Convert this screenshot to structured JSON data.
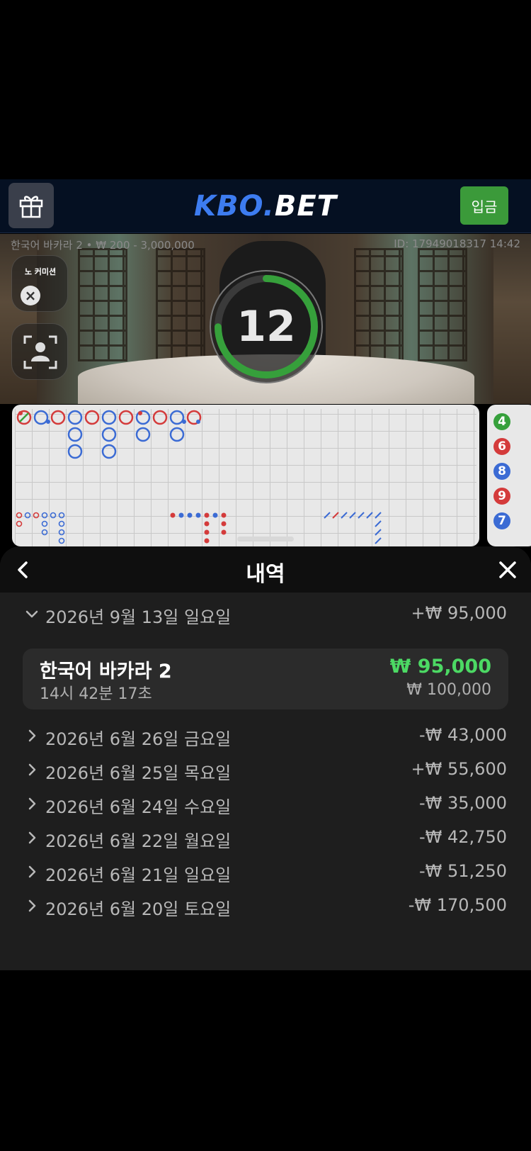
{
  "header": {
    "logo_kbo": "KBO",
    "logo_dot": ".",
    "logo_bet": "BET",
    "deposit_label": "입금"
  },
  "table": {
    "name_limits": "한국어 바카라 2 • ₩ 200 - 3,000,000",
    "id_time": "ID: 17949018317 14:42",
    "no_commission": "노 커미션",
    "countdown": "12"
  },
  "bead_road": [
    "4",
    "6",
    "8",
    "9",
    "7"
  ],
  "sheet": {
    "title": "내역",
    "expanded_day": {
      "date": "2026년 9월 13일 일요일",
      "amount": "+₩ 95,000",
      "game": {
        "name": "한국어 바카라 2",
        "time": "14시 42분 17초",
        "win": "₩ 95,000",
        "bet": "₩ 100,000"
      }
    },
    "days": [
      {
        "date": "2026년 6월 26일 금요일",
        "amount": "-₩ 43,000"
      },
      {
        "date": "2026년 6월 25일 목요일",
        "amount": "+₩ 55,600"
      },
      {
        "date": "2026년 6월 24일 수요일",
        "amount": "-₩ 35,000"
      },
      {
        "date": "2026년 6월 22일 월요일",
        "amount": "-₩ 42,750"
      },
      {
        "date": "2026년 6월 21일 일요일",
        "amount": "-₩ 51,250"
      },
      {
        "date": "2026년 6월 20일 토요일",
        "amount": "-₩ 170,500"
      }
    ]
  },
  "colors": {
    "accent_green": "#3b9a3a",
    "win_green": "#4cd964",
    "logo_blue": "#3d7cf0",
    "player_blue": "#3b6bd4",
    "banker_red": "#d43b3b"
  }
}
